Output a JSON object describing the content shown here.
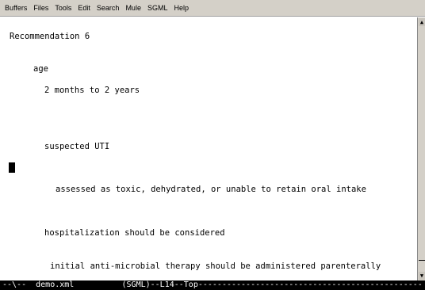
{
  "menubar": {
    "items": [
      "Buffers",
      "Files",
      "Tools",
      "Edit",
      "Search",
      "Mule",
      "SGML",
      "Help"
    ]
  },
  "editor": {
    "lines": [
      "Recommendation 6",
      "age",
      "2 months to 2 years",
      "suspected UTI",
      "assessed as toxic, dehydrated, or unable to retain oral intake",
      "hospitalization should be considered",
      "initial anti-microbial therapy should be administered parenterally"
    ]
  },
  "scrollbar": {
    "up_icon": "▲",
    "down_icon": "▼"
  },
  "modeline": {
    "text": "--\\--  demo.xml          (SGML)--L14--Top-----------------------------------------------"
  }
}
